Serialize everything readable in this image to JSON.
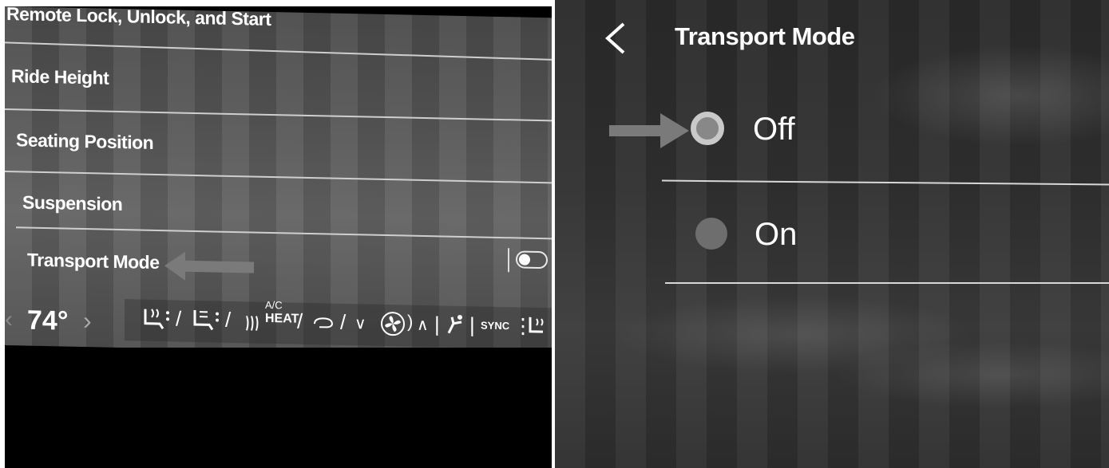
{
  "left": {
    "menu": [
      {
        "label": "Remote Lock, Unlock, and Start"
      },
      {
        "label": "Ride Height"
      },
      {
        "label": "Seating Position"
      },
      {
        "label": "Suspension"
      },
      {
        "label": "Transport Mode"
      }
    ],
    "toggle_state": "off",
    "climate": {
      "temperature": "74°",
      "ac_label": "A/C",
      "heat_label": "HEAT",
      "sync_label": "SYNC",
      "icons": [
        "chevron-left-icon",
        "chevron-right-icon",
        "heated-seat-icon",
        "cooled-seat-icon",
        "rear-defrost-icon",
        "recirculation-icon",
        "fan-down-icon",
        "fan-icon",
        "fan-up-icon",
        "airflow-icon",
        "heated-steering-icon"
      ]
    }
  },
  "right": {
    "back_icon": "chevron-left-icon",
    "title": "Transport Mode",
    "options": [
      {
        "label": "Off",
        "selected": true
      },
      {
        "label": "On",
        "selected": false
      }
    ]
  },
  "annotations": {
    "arrow_color": "#7a7a7a"
  }
}
